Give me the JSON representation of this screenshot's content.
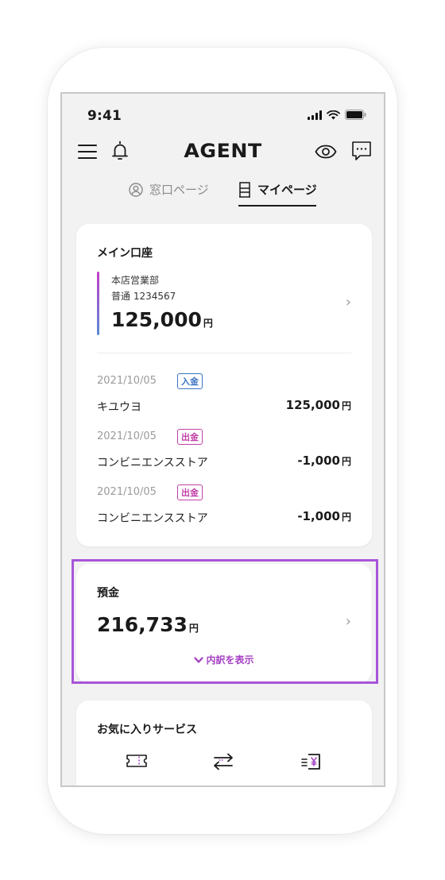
{
  "status_bar": {
    "time": "9:41"
  },
  "header": {
    "logo": "AGENT"
  },
  "tabs": [
    {
      "label": "窓口ページ",
      "active": false
    },
    {
      "label": "マイページ",
      "active": true
    }
  ],
  "main_account": {
    "title": "メイン口座",
    "branch": "本店営業部",
    "account": "普通 1234567",
    "balance": "125,000",
    "currency": "円"
  },
  "transactions": [
    {
      "date": "2021/10/05",
      "type": "入金",
      "name": "キユウヨ",
      "amount": "125,000",
      "currency": "円"
    },
    {
      "date": "2021/10/05",
      "type": "出金",
      "name": "コンビニエンスストア",
      "amount": "-1,000",
      "currency": "円"
    },
    {
      "date": "2021/10/05",
      "type": "出金",
      "name": "コンビニエンスストア",
      "amount": "-1,000",
      "currency": "円"
    }
  ],
  "deposit": {
    "title": "預金",
    "amount": "216,733",
    "currency": "円",
    "breakdown_label": "内訳を表示"
  },
  "favorites": {
    "title": "お気に入りサービス",
    "icons": [
      "ticket-icon",
      "transfer-icon",
      "yen-receipt-icon"
    ]
  },
  "colors": {
    "accent_purple": "#a53fc4",
    "deposit_type": "#3b73c4",
    "withdraw_type": "#c23fa8",
    "highlight": "#a855d8"
  }
}
